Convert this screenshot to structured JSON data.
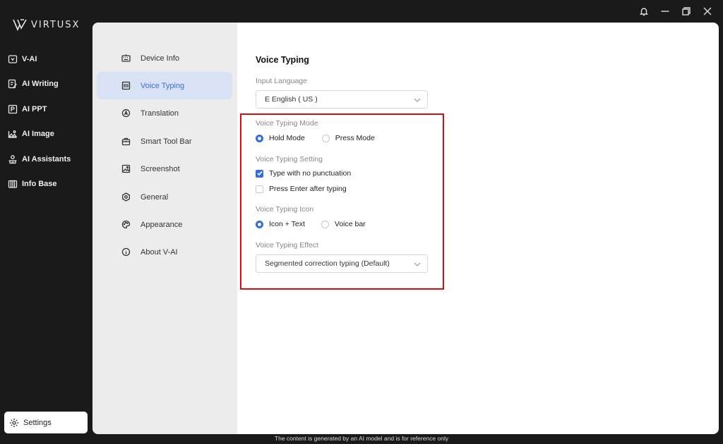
{
  "window": {
    "controls": [
      "bell-icon",
      "minimize-icon",
      "restore-icon",
      "close-icon"
    ]
  },
  "brand": {
    "name": "VIRTUSX"
  },
  "nav": {
    "items": [
      {
        "label": "V-AI",
        "icon": "vai-icon"
      },
      {
        "label": "AI Writing",
        "icon": "writing-icon"
      },
      {
        "label": "AI PPT",
        "icon": "ppt-icon"
      },
      {
        "label": "AI Image",
        "icon": "image-icon"
      },
      {
        "label": "AI Assistants",
        "icon": "assistant-icon"
      },
      {
        "label": "Info Base",
        "icon": "library-icon"
      }
    ],
    "settings_label": "Settings"
  },
  "subnav": {
    "items": [
      {
        "label": "Device Info",
        "icon": "keyboard-icon"
      },
      {
        "label": "Voice Typing",
        "icon": "voice-typing-icon",
        "active": true
      },
      {
        "label": "Translation",
        "icon": "translate-icon"
      },
      {
        "label": "Smart Tool Bar",
        "icon": "toolbox-icon"
      },
      {
        "label": "Screenshot",
        "icon": "screenshot-icon"
      },
      {
        "label": "General",
        "icon": "gear-icon"
      },
      {
        "label": "Appearance",
        "icon": "palette-icon"
      },
      {
        "label": "About V-AI",
        "icon": "info-icon"
      }
    ]
  },
  "content": {
    "title": "Voice Typing",
    "input_language": {
      "label": "Input Language",
      "value": "E English ( US )"
    },
    "mode": {
      "label": "Voice Typing Mode",
      "options": [
        "Hold Mode",
        "Press Mode"
      ],
      "selected": "Hold Mode"
    },
    "setting": {
      "label": "Voice Typing Setting",
      "options": [
        {
          "label": "Type with no punctuation",
          "checked": true
        },
        {
          "label": "Press Enter after typing",
          "checked": false
        }
      ]
    },
    "icon": {
      "label": "Voice Typing Icon",
      "options": [
        "Icon + Text",
        "Voice bar"
      ],
      "selected": "Icon + Text"
    },
    "effect": {
      "label": "Voice Typing Effect",
      "value": "Segmented correction typing (Default)"
    }
  },
  "colors": {
    "accent": "#2f6de0",
    "active_bg": "#d9e2f5",
    "highlight_border": "#d40f0f",
    "sidebar_bg": "#1a1a1a"
  },
  "footer": {
    "note": "The content is generated by an AI model and is for reference only"
  }
}
